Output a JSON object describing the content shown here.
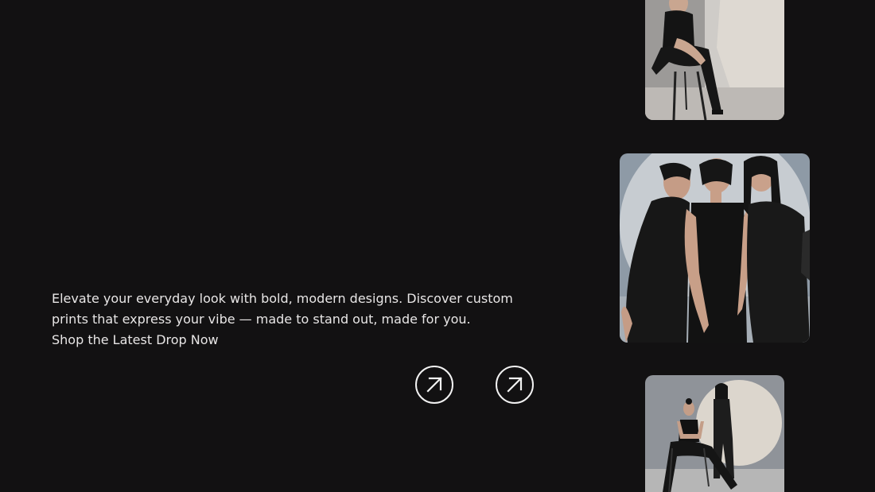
{
  "hero": {
    "description": "Elevate your everyday look with bold, modern designs. Discover custom prints that express your vibe — made to stand out, made for you.",
    "cta": "Shop the Latest Drop Now"
  },
  "buttons": {
    "icon": "arrow-up-right-icon"
  },
  "gallery": {
    "photos": [
      "model-seated-on-stool",
      "three-models-group",
      "two-models-seated-and-standing"
    ]
  },
  "colors": {
    "background": "#121112",
    "text": "#e8e6e6",
    "button_border": "#f2f2f2"
  }
}
